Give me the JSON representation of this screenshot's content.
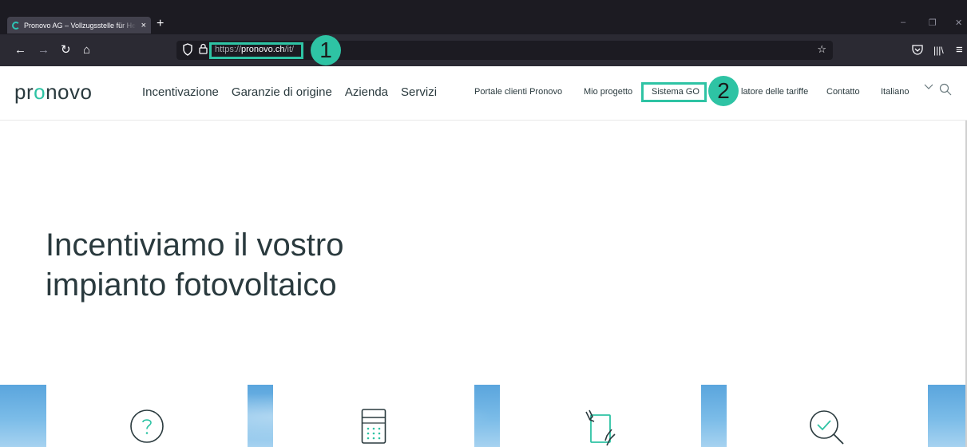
{
  "browser": {
    "tab_title": "Pronovo AG – Vollzugsstelle für Herkunftsnachweise",
    "tab_close": "×",
    "new_tab": "+",
    "url_prefix": "https://",
    "url_host": "pronovo.ch",
    "url_path": "/it/",
    "window_controls": [
      "–",
      "❐",
      "✕"
    ],
    "nav_icons": [
      "back-icon",
      "forward-icon",
      "reload-icon",
      "home-icon",
      "shield-icon",
      "lock-icon",
      "star-icon",
      "pocket-icon",
      "library-icon",
      "menu-icon"
    ]
  },
  "annotations": {
    "badge_1": "1",
    "badge_2": "2",
    "accent_color": "#2ec3a4"
  },
  "site": {
    "logo_pre": "pr",
    "logo_accent": "o",
    "logo_post": "novo",
    "main_nav": [
      "Incentivazione",
      "Garanzie di origine",
      "Azienda",
      "Servizi"
    ],
    "sub_nav": {
      "portal": "Portale clienti Pronovo",
      "project": "Mio progetto",
      "go_system": "Sistema GO",
      "tariff": "latore delle tariffe",
      "contact": "Contatto",
      "language": "Italiano"
    }
  },
  "hero": {
    "title_line1": "Incentiviamo il vostro",
    "title_line2": "impianto fotovoltaico"
  },
  "cards": [
    {
      "icon": "question-icon"
    },
    {
      "icon": "calculator-icon"
    },
    {
      "icon": "document-hand-icon"
    },
    {
      "icon": "search-check-icon"
    }
  ]
}
